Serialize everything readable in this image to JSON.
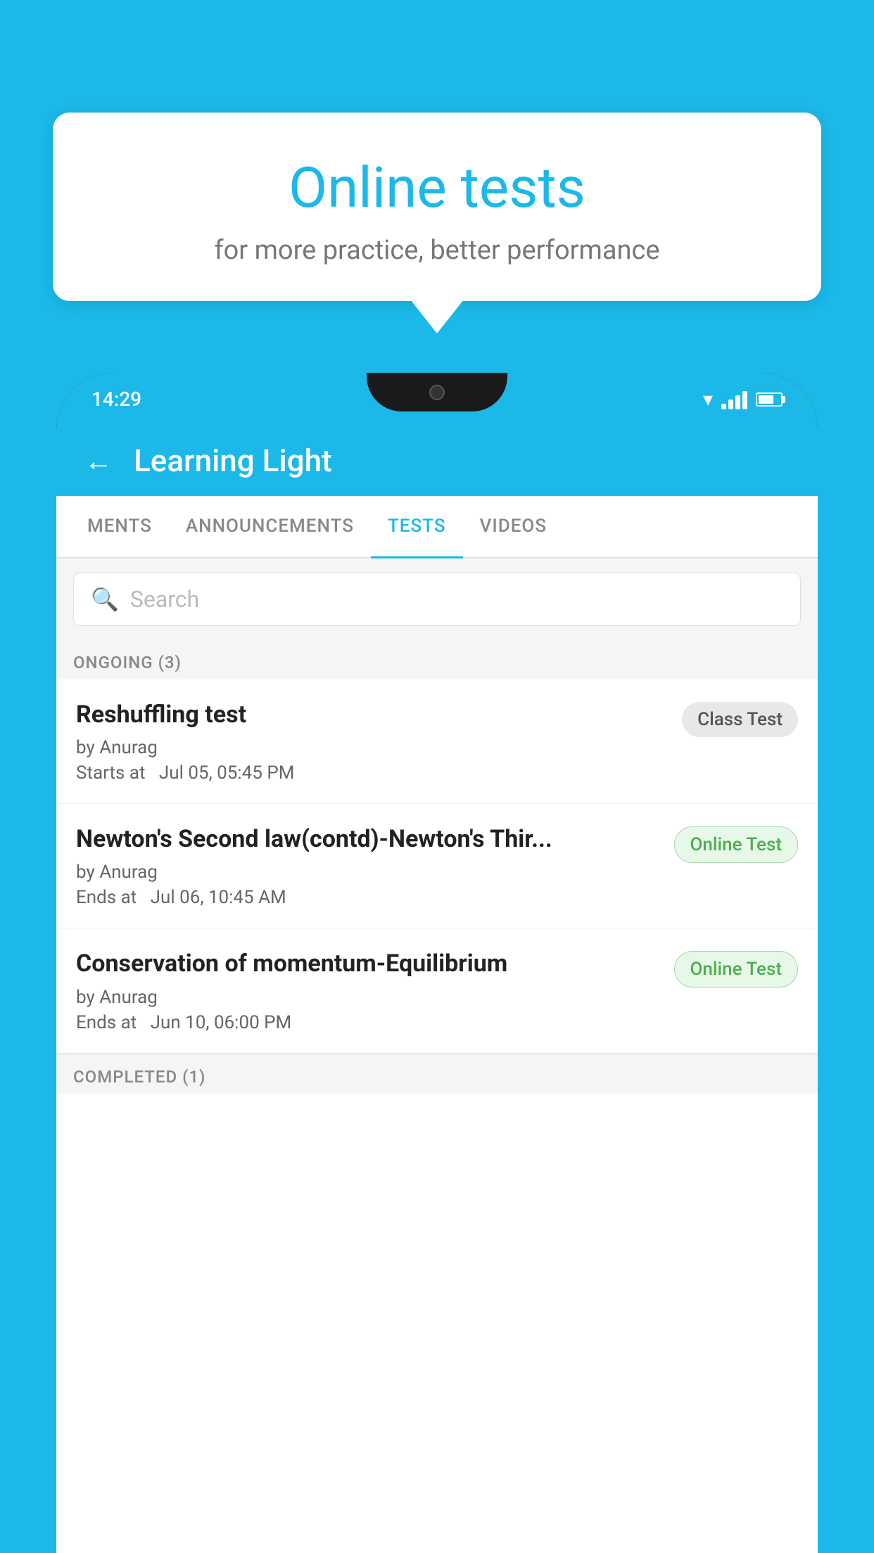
{
  "background": {
    "color": "#1BB8E8"
  },
  "bubble": {
    "title": "Online tests",
    "subtitle": "for more practice, better performance"
  },
  "phone": {
    "status_bar": {
      "time": "14:29"
    },
    "app_header": {
      "title": "Learning Light",
      "back_label": "←"
    },
    "tabs": [
      {
        "label": "MENTS",
        "active": false
      },
      {
        "label": "ANNOUNCEMENTS",
        "active": false
      },
      {
        "label": "TESTS",
        "active": true
      },
      {
        "label": "VIDEOS",
        "active": false
      }
    ],
    "search": {
      "placeholder": "Search"
    },
    "ongoing_section": {
      "label": "ONGOING (3)"
    },
    "tests": [
      {
        "title": "Reshuffling test",
        "author": "by Anurag",
        "date": "Starts at  Jul 05, 05:45 PM",
        "badge": "Class Test",
        "badge_type": "class"
      },
      {
        "title": "Newton's Second law(contd)-Newton's Thir...",
        "author": "by Anurag",
        "date": "Ends at  Jul 06, 10:45 AM",
        "badge": "Online Test",
        "badge_type": "online"
      },
      {
        "title": "Conservation of momentum-Equilibrium",
        "author": "by Anurag",
        "date": "Ends at  Jun 10, 06:00 PM",
        "badge": "Online Test",
        "badge_type": "online"
      }
    ],
    "completed_section": {
      "label": "COMPLETED (1)"
    }
  }
}
